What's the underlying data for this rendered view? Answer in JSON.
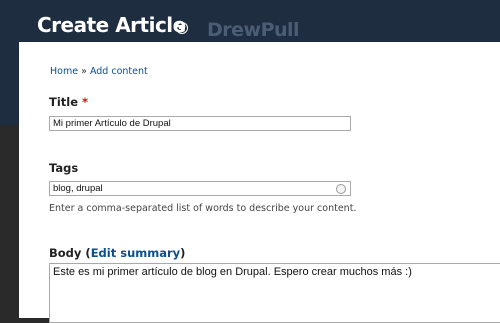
{
  "header": {
    "title": "Create Article",
    "watermark": "DrewPull"
  },
  "breadcrumb": {
    "home": "Home",
    "separator": "»",
    "add_content": "Add content"
  },
  "form": {
    "title": {
      "label": "Title",
      "required_marker": "*",
      "value": "Mi primer Artículo de Drupal"
    },
    "tags": {
      "label": "Tags",
      "value": "blog, drupal",
      "description": "Enter a comma-separated list of words to describe your content."
    },
    "body": {
      "label": "Body",
      "open_paren": "(",
      "edit_summary_link": "Edit summary",
      "close_paren": ")",
      "value": "Este es mi primer artículo de blog en Drupal. Espero crear muchos más :)"
    }
  },
  "colors": {
    "header_bg": "#1e2d3f",
    "link": "#0a4f8f",
    "required": "#cc1111"
  },
  "icons": [
    "add-shortcut-icon",
    "autocomplete-throbber-icon"
  ]
}
